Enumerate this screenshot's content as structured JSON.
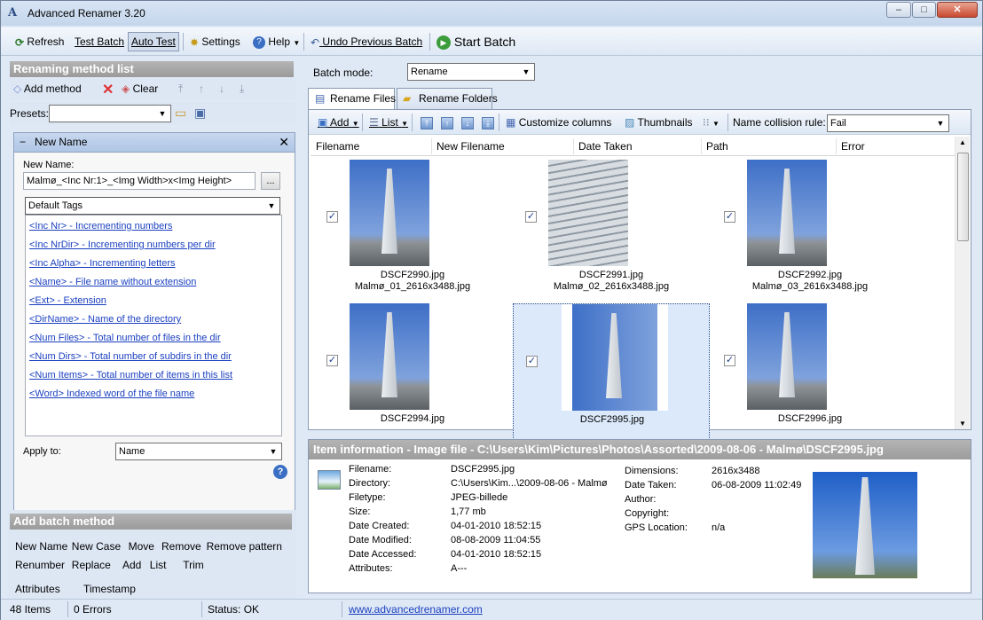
{
  "window": {
    "title": "Advanced Renamer 3.20",
    "min": "‒",
    "max": "□",
    "close": "✕",
    "app_icon": "A"
  },
  "toolbar": {
    "refresh": "Refresh",
    "test_batch": "Test Batch",
    "auto_test": "Auto Test",
    "settings": "Settings",
    "help": "Help",
    "undo": "Undo Previous Batch",
    "start": "Start Batch"
  },
  "left": {
    "method_list_title": "Renaming method list",
    "add_method": "Add method",
    "clear": "Clear",
    "presets_label": "Presets:",
    "method": {
      "header": "New Name",
      "collapse": "−",
      "close": "✕",
      "new_name_label": "New Name:",
      "new_name_value": "Malmø_<Inc Nr:1>_<Img Width>x<Img Height>",
      "browse": "...",
      "tags_dropdown": "Default Tags",
      "tags": [
        "<Inc Nr> - Incrementing numbers",
        "<Inc NrDir> - Incrementing numbers per dir",
        "<Inc Alpha> - Incrementing letters",
        "<Name> - File name without extension",
        "<Ext> - Extension",
        "<DirName> - Name of the directory",
        "<Num Files> - Total number of files in the dir",
        "<Num Dirs> - Total number of subdirs in the dir",
        "<Num Items> - Total number of items in this list",
        "<Word> Indexed word of the file name"
      ],
      "apply_to_label": "Apply to:",
      "apply_to_value": "Name",
      "help": "?"
    },
    "batch_title": "Add batch method",
    "batch_methods_row1": [
      "New Name",
      "New Case",
      "Move",
      "Remove",
      "Remove pattern"
    ],
    "batch_methods_row2": [
      "Renumber",
      "Replace",
      "Add",
      "List",
      "Trim"
    ],
    "batch_methods_row3": [
      "Attributes",
      "Timestamp"
    ]
  },
  "right": {
    "batch_mode_label": "Batch mode:",
    "batch_mode_value": "Rename",
    "tabs": [
      "Rename Files",
      "Rename Folders"
    ],
    "ftoolbar": {
      "add": "Add",
      "list": "List",
      "customize": "Customize columns",
      "thumbnails": "Thumbnails",
      "collision_label": "Name collision rule:",
      "collision_value": "Fail"
    },
    "columns": [
      "Filename",
      "New Filename",
      "Date Taken",
      "Path",
      "Error"
    ],
    "files": [
      {
        "name": "DSCF2990.jpg",
        "new": "Malmø_01_2616x3488.jpg"
      },
      {
        "name": "DSCF2991.jpg",
        "new": "Malmø_02_2616x3488.jpg"
      },
      {
        "name": "DSCF2992.jpg",
        "new": "Malmø_03_2616x3488.jpg"
      },
      {
        "name": "DSCF2994.jpg",
        "new": ""
      },
      {
        "name": "DSCF2995.jpg",
        "new": ""
      },
      {
        "name": "DSCF2996.jpg",
        "new": ""
      }
    ],
    "info": {
      "title": "Item information - Image file - C:\\Users\\Kim\\Pictures\\Photos\\Assorted\\2009-08-06 - Malmø\\DSCF2995.jpg",
      "left_keys": [
        "Filename:",
        "Directory:",
        "Filetype:",
        "Size:",
        "Date Created:",
        "Date Modified:",
        "Date Accessed:",
        "Attributes:"
      ],
      "left_vals": [
        "DSCF2995.jpg",
        "C:\\Users\\Kim...\\2009-08-06 - Malmø",
        "JPEG-billede",
        "1,77 mb",
        "04-01-2010 18:52:15",
        "08-08-2009 11:04:55",
        "04-01-2010 18:52:15",
        "A---"
      ],
      "right_keys": [
        "Dimensions:",
        "Date Taken:",
        "Author:",
        "Copyright:",
        "GPS Location:"
      ],
      "right_vals": [
        "2616x3488",
        "06-08-2009 11:02:49",
        "",
        "",
        "n/a"
      ]
    }
  },
  "status": {
    "items": "48 Items",
    "errors": "0 Errors",
    "status": "Status: OK",
    "link": "www.advancedrenamer.com"
  }
}
